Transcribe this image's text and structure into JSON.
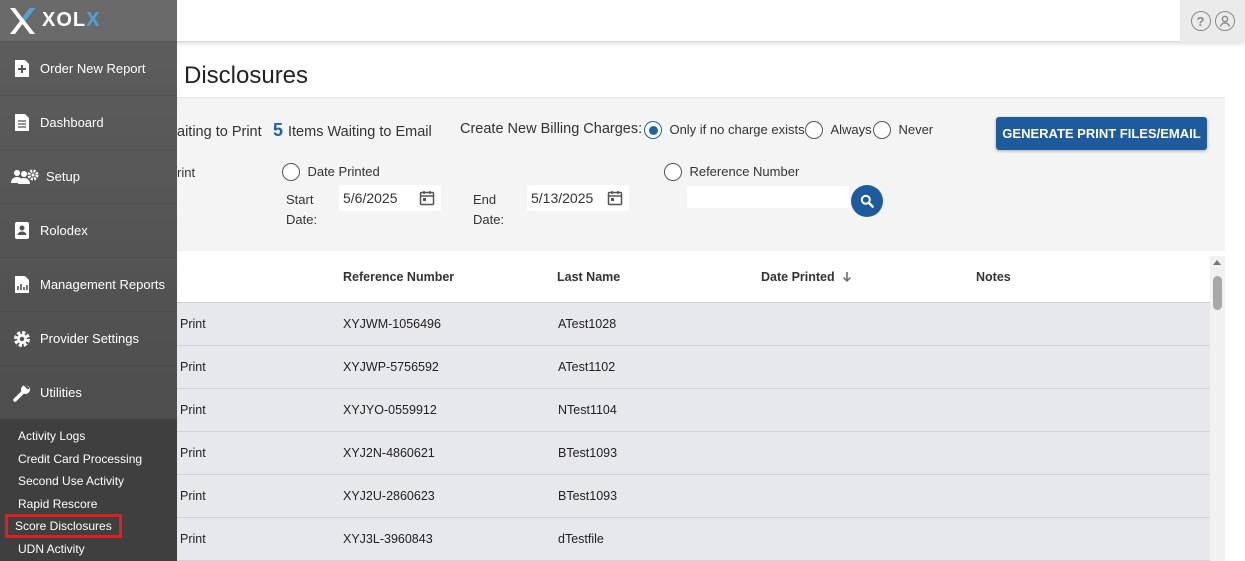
{
  "app": {
    "logo_text_1": "XOL",
    "logo_text_2": "X"
  },
  "sidebar": {
    "items": [
      {
        "label": "Order New Report",
        "icon": "file-plus-icon"
      },
      {
        "label": "Dashboard",
        "icon": "document-icon"
      },
      {
        "label": "Setup",
        "icon": "users-gear-icon"
      },
      {
        "label": "Rolodex",
        "icon": "address-book-icon"
      },
      {
        "label": "Management Reports",
        "icon": "report-chart-icon"
      },
      {
        "label": "Provider Settings",
        "icon": "gear-icon"
      },
      {
        "label": "Utilities",
        "icon": "wrench-icon"
      }
    ],
    "sub_items": [
      {
        "label": "Activity Logs"
      },
      {
        "label": "Credit Card Processing"
      },
      {
        "label": "Second Use Activity"
      },
      {
        "label": "Rapid Rescore"
      },
      {
        "label": "Score Disclosures",
        "active": true
      },
      {
        "label": "UDN Activity"
      }
    ]
  },
  "page": {
    "title": "Disclosures"
  },
  "filters": {
    "waiting_print_label": "aiting to Print",
    "waiting_email_count": "5",
    "waiting_email_label": "Items Waiting to Email",
    "billing_label": "Create New Billing Charges:",
    "billing_options": [
      {
        "label": "Only if no charge exists",
        "checked": true
      },
      {
        "label": "Always",
        "checked": false
      },
      {
        "label": "Never",
        "checked": false
      }
    ],
    "generate_button": "GENERATE PRINT FILES/EMAIL",
    "partial_radio_label": "rint",
    "date_printed_label": "Date Printed",
    "start_label_1": "Start",
    "start_label_2": "Date:",
    "start_value": "5/6/2025",
    "end_label_1": "End",
    "end_label_2": "Date:",
    "end_value": "5/13/2025",
    "reference_label": "Reference Number",
    "reference_value": ""
  },
  "table": {
    "columns": [
      "Reference Number",
      "Last Name",
      "Date Printed",
      "Notes"
    ],
    "rows": [
      {
        "status": "Print",
        "reference": "XYJWM-1056496",
        "last_name": "ATest1028",
        "date_printed": "",
        "notes": ""
      },
      {
        "status": "Print",
        "reference": "XYJWP-5756592",
        "last_name": "ATest1102",
        "date_printed": "",
        "notes": ""
      },
      {
        "status": "Print",
        "reference": "XYJYO-0559912",
        "last_name": "NTest1104",
        "date_printed": "",
        "notes": ""
      },
      {
        "status": "Print",
        "reference": "XYJ2N-4860621",
        "last_name": "BTest1093",
        "date_printed": "",
        "notes": ""
      },
      {
        "status": "Print",
        "reference": "XYJ2U-2860623",
        "last_name": "BTest1093",
        "date_printed": "",
        "notes": ""
      },
      {
        "status": "Print",
        "reference": "XYJ3L-3960843",
        "last_name": "dTestfile",
        "date_printed": "",
        "notes": ""
      }
    ]
  },
  "colors": {
    "accent": "#1e5a9e",
    "sidebar_bg": "#555555",
    "active_outline": "#e02020"
  }
}
